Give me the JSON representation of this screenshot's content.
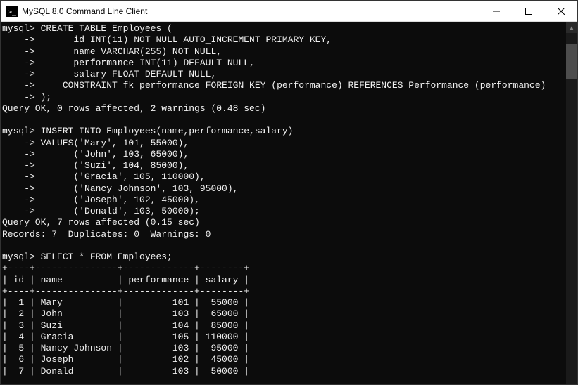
{
  "window": {
    "title": "MySQL 8.0 Command Line Client"
  },
  "terminal": {
    "prompt": "mysql>",
    "cont": "    ->",
    "create_table": {
      "header": " CREATE TABLE Employees (",
      "col_id": "       id INT(11) NOT NULL AUTO_INCREMENT PRIMARY KEY,",
      "col_name": "       name VARCHAR(255) NOT NULL,",
      "col_perf": "       performance INT(11) DEFAULT NULL,",
      "col_salary": "       salary FLOAT DEFAULT NULL,",
      "constraint": "     CONSTRAINT fk_performance FOREIGN KEY (performance) REFERENCES Performance (performance)",
      "close": " );",
      "result": "Query OK, 0 rows affected, 2 warnings (0.48 sec)"
    },
    "insert": {
      "header": " INSERT INTO Employees(name,performance,salary)",
      "v1": " VALUES('Mary', 101, 55000),",
      "v2": "       ('John', 103, 65000),",
      "v3": "       ('Suzi', 104, 85000),",
      "v4": "       ('Gracia', 105, 110000),",
      "v5": "       ('Nancy Johnson', 103, 95000),",
      "v6": "       ('Joseph', 102, 45000),",
      "v7": "       ('Donald', 103, 50000);",
      "result1": "Query OK, 7 rows affected (0.15 sec)",
      "result2": "Records: 7  Duplicates: 0  Warnings: 0"
    },
    "select": {
      "query": " SELECT * FROM Employees;",
      "border": "+----+---------------+-------------+--------+",
      "header": "| id | name          | performance | salary |",
      "rows": [
        "|  1 | Mary          |         101 |  55000 |",
        "|  2 | John          |         103 |  65000 |",
        "|  3 | Suzi          |         104 |  85000 |",
        "|  4 | Gracia        |         105 | 110000 |",
        "|  5 | Nancy Johnson |         103 |  95000 |",
        "|  6 | Joseph        |         102 |  45000 |",
        "|  7 | Donald        |         103 |  50000 |"
      ]
    }
  },
  "chart_data": {
    "type": "table",
    "title": "Employees",
    "columns": [
      "id",
      "name",
      "performance",
      "salary"
    ],
    "rows": [
      {
        "id": 1,
        "name": "Mary",
        "performance": 101,
        "salary": 55000
      },
      {
        "id": 2,
        "name": "John",
        "performance": 103,
        "salary": 65000
      },
      {
        "id": 3,
        "name": "Suzi",
        "performance": 104,
        "salary": 85000
      },
      {
        "id": 4,
        "name": "Gracia",
        "performance": 105,
        "salary": 110000
      },
      {
        "id": 5,
        "name": "Nancy Johnson",
        "performance": 103,
        "salary": 95000
      },
      {
        "id": 6,
        "name": "Joseph",
        "performance": 102,
        "salary": 45000
      },
      {
        "id": 7,
        "name": "Donald",
        "performance": 103,
        "salary": 50000
      }
    ]
  }
}
